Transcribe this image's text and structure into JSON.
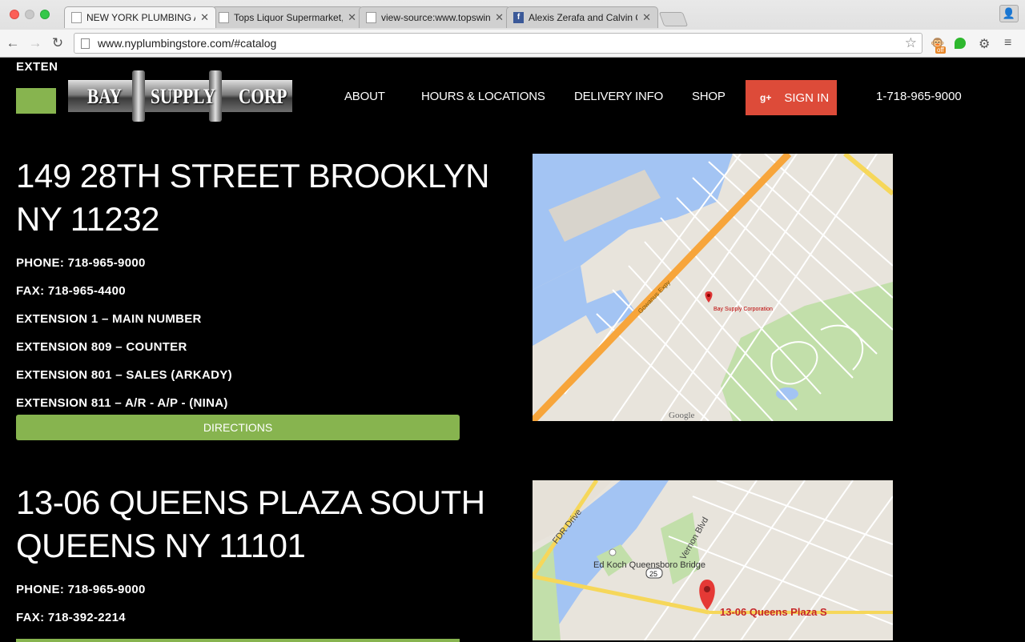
{
  "browser": {
    "tabs": [
      {
        "title": "NEW YORK PLUMBING AND",
        "active": true,
        "icon": "page-icon"
      },
      {
        "title": "Tops Liquor Supermarket, Inc",
        "active": false,
        "icon": "page-icon"
      },
      {
        "title": "view-source:www.topswine",
        "active": false,
        "icon": "page-icon"
      },
      {
        "title": "Alexis Zerafa and Calvin O",
        "active": false,
        "icon": "facebook-icon"
      }
    ],
    "url": "www.nyplumbingstore.com/#catalog",
    "extension_badge": "off"
  },
  "site": {
    "exten_label": "EXTEN",
    "logo": {
      "word1": "BAY",
      "word2": "SUPPLY",
      "word3": "CORP"
    },
    "nav": {
      "about": "ABOUT",
      "hours": "HOURS & LOCATIONS",
      "delivery": "DELIVERY INFO",
      "shop": "SHOP",
      "signin": "SIGN IN",
      "signin_icon": "g+",
      "phone": "1-718-965-9000"
    },
    "colors": {
      "accent_green": "#87b44f",
      "signin_red": "#dd4b39"
    },
    "locations": [
      {
        "address_line1": "149 28TH STREET BROOKLYN",
        "address_line2": "NY 11232",
        "phone": "PHONE: 718-965-9000",
        "fax": "FAX: 718-965-4400",
        "ext1": "EXTENSION 1 – MAIN NUMBER",
        "ext2": "EXTENSION 809 – COUNTER",
        "ext3": "EXTENSION 801 – SALES (ARKADY)",
        "ext4": "EXTENSION 811 – A/R - A/P - (NINA)",
        "directions": "DIRECTIONS",
        "map": {
          "marker_label": "Bay Supply Corporation",
          "logo": "Google",
          "road": "Gowanus Expy"
        }
      },
      {
        "address_line1": "13-06 QUEENS PLAZA SOUTH",
        "address_line2": "QUEENS NY 11101",
        "phone": "PHONE: 718-965-9000",
        "fax": "FAX: 718-392-2214",
        "map": {
          "marker_label": "13-06 Queens Plaza S",
          "bridge": "Ed Koch Queensboro Bridge",
          "road1": "FDR Drive",
          "road2": "Vernon Blvd",
          "route": "25"
        }
      }
    ]
  }
}
